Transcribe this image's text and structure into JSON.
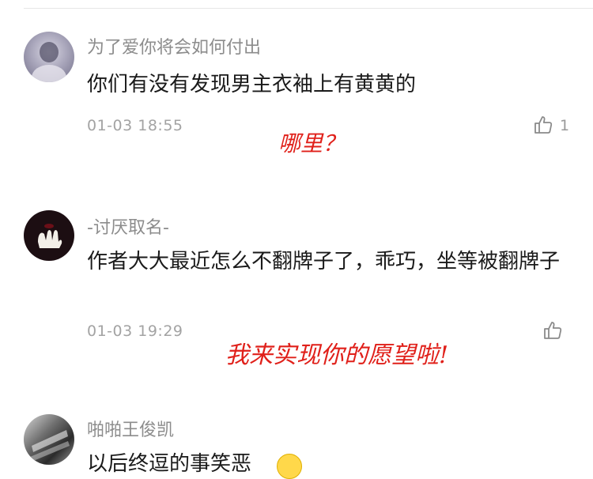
{
  "comments": [
    {
      "username": "为了爱你将会如何付出",
      "text": "你们有没有发现男主衣袖上有黄黄的",
      "time": "01-03 18:55",
      "likes": "1",
      "avatar_icon": "avatar-grey-portrait",
      "annotation": "哪里？"
    },
    {
      "username": "-讨厌取名-",
      "text": "作者大大最近怎么不翻牌子了，乖巧，坐等被翻牌子",
      "time": "01-03 19:29",
      "likes": "",
      "avatar_icon": "avatar-dark-hands",
      "annotation": "我来实现你的愿望啦!"
    },
    {
      "username": "啪啪王俊凯",
      "text": "以后终逗的事笑恶",
      "time": "",
      "likes": "",
      "avatar_icon": "avatar-photo"
    }
  ],
  "colors": {
    "annotation": "#e0201a",
    "username": "#8c8c8c",
    "time": "#a3a3a3"
  }
}
